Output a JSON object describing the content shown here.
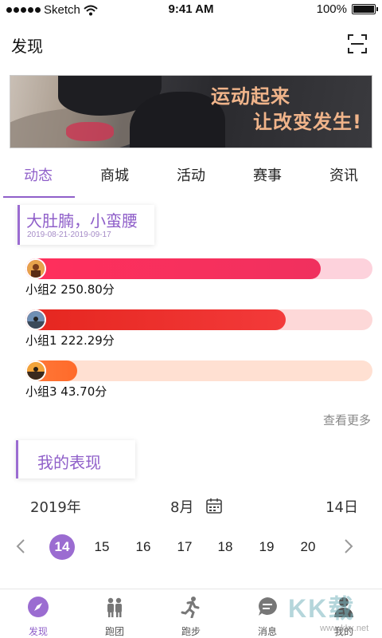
{
  "status_bar": {
    "carrier": "Sketch",
    "time": "9:41 AM",
    "battery": "100%"
  },
  "nav": {
    "title": "发现"
  },
  "banner": {
    "line1": "运动起来",
    "line2": "让改变发生!"
  },
  "tabs": [
    {
      "label": "动态",
      "active": true
    },
    {
      "label": "商城"
    },
    {
      "label": "活动"
    },
    {
      "label": "赛事"
    },
    {
      "label": "资讯"
    }
  ],
  "competition": {
    "title": "大肚腩，小蛮腰",
    "date_range": "2019-08-21-2019-09-17"
  },
  "rankings": [
    {
      "label": "小组2  250.80分",
      "progress": 0.85,
      "color": "red-pink"
    },
    {
      "label": "小组1  222.29分",
      "progress": 0.75,
      "color": "red"
    },
    {
      "label": "小组3  43.70分",
      "progress": 0.15,
      "color": "orange"
    }
  ],
  "more_link": "查看更多",
  "performance": {
    "title": "我的表现",
    "year": "2019年",
    "month": "8月",
    "day": "14日",
    "days": [
      "14",
      "15",
      "16",
      "17",
      "18",
      "19",
      "20"
    ],
    "selected_day": "14"
  },
  "tabbar": [
    {
      "label": "发现",
      "icon": "compass-icon",
      "active": true
    },
    {
      "label": "跑团",
      "icon": "group-icon"
    },
    {
      "label": "跑步",
      "icon": "runner-icon"
    },
    {
      "label": "消息",
      "icon": "chat-icon"
    },
    {
      "label": "我的",
      "icon": "user-icon"
    }
  ],
  "watermark": {
    "text": "KK载",
    "url": "www.kkx.net"
  }
}
